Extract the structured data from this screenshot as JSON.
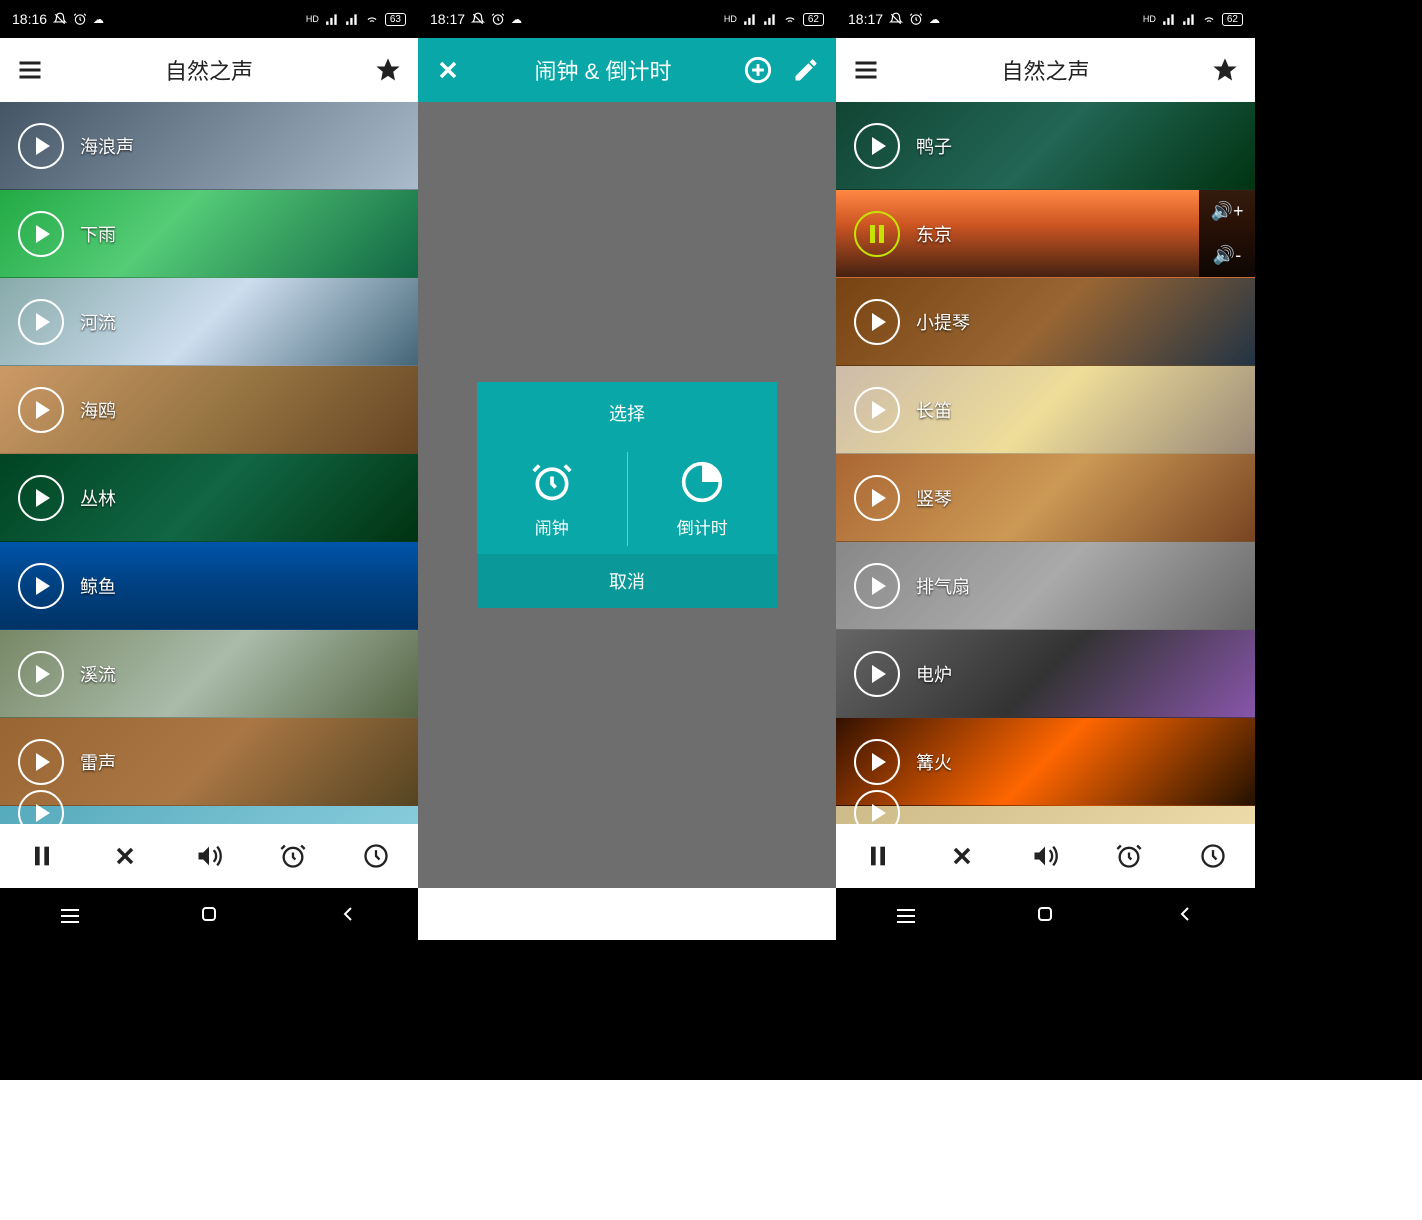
{
  "screens": [
    {
      "status": {
        "time": "18:16",
        "battery": "63"
      },
      "header": {
        "title": "自然之声"
      },
      "sounds": [
        {
          "label": "海浪声",
          "bg": "bg-waves"
        },
        {
          "label": "下雨",
          "bg": "bg-rain"
        },
        {
          "label": "河流",
          "bg": "bg-river"
        },
        {
          "label": "海鸥",
          "bg": "bg-gull"
        },
        {
          "label": "丛林",
          "bg": "bg-jungle"
        },
        {
          "label": "鲸鱼",
          "bg": "bg-whale"
        },
        {
          "label": "溪流",
          "bg": "bg-stream"
        },
        {
          "label": "雷声",
          "bg": "bg-thunder"
        }
      ]
    },
    {
      "status": {
        "time": "18:17",
        "battery": "62"
      },
      "header": {
        "title": "闹钟 & 倒计时"
      },
      "modal": {
        "title": "选择",
        "options": [
          {
            "label": "闹钟"
          },
          {
            "label": "倒计时"
          }
        ],
        "cancel": "取消"
      }
    },
    {
      "status": {
        "time": "18:17",
        "battery": "62"
      },
      "header": {
        "title": "自然之声"
      },
      "sounds": [
        {
          "label": "鸭子",
          "bg": "bg-duck"
        },
        {
          "label": "东京",
          "bg": "bg-tokyo",
          "playing": true,
          "volume": true
        },
        {
          "label": "小提琴",
          "bg": "bg-violin"
        },
        {
          "label": "长笛",
          "bg": "bg-flute"
        },
        {
          "label": "竖琴",
          "bg": "bg-harp"
        },
        {
          "label": "排气扇",
          "bg": "bg-fan"
        },
        {
          "label": "电炉",
          "bg": "bg-stove"
        },
        {
          "label": "篝火",
          "bg": "bg-fire"
        }
      ]
    }
  ],
  "signal_label": "HD"
}
